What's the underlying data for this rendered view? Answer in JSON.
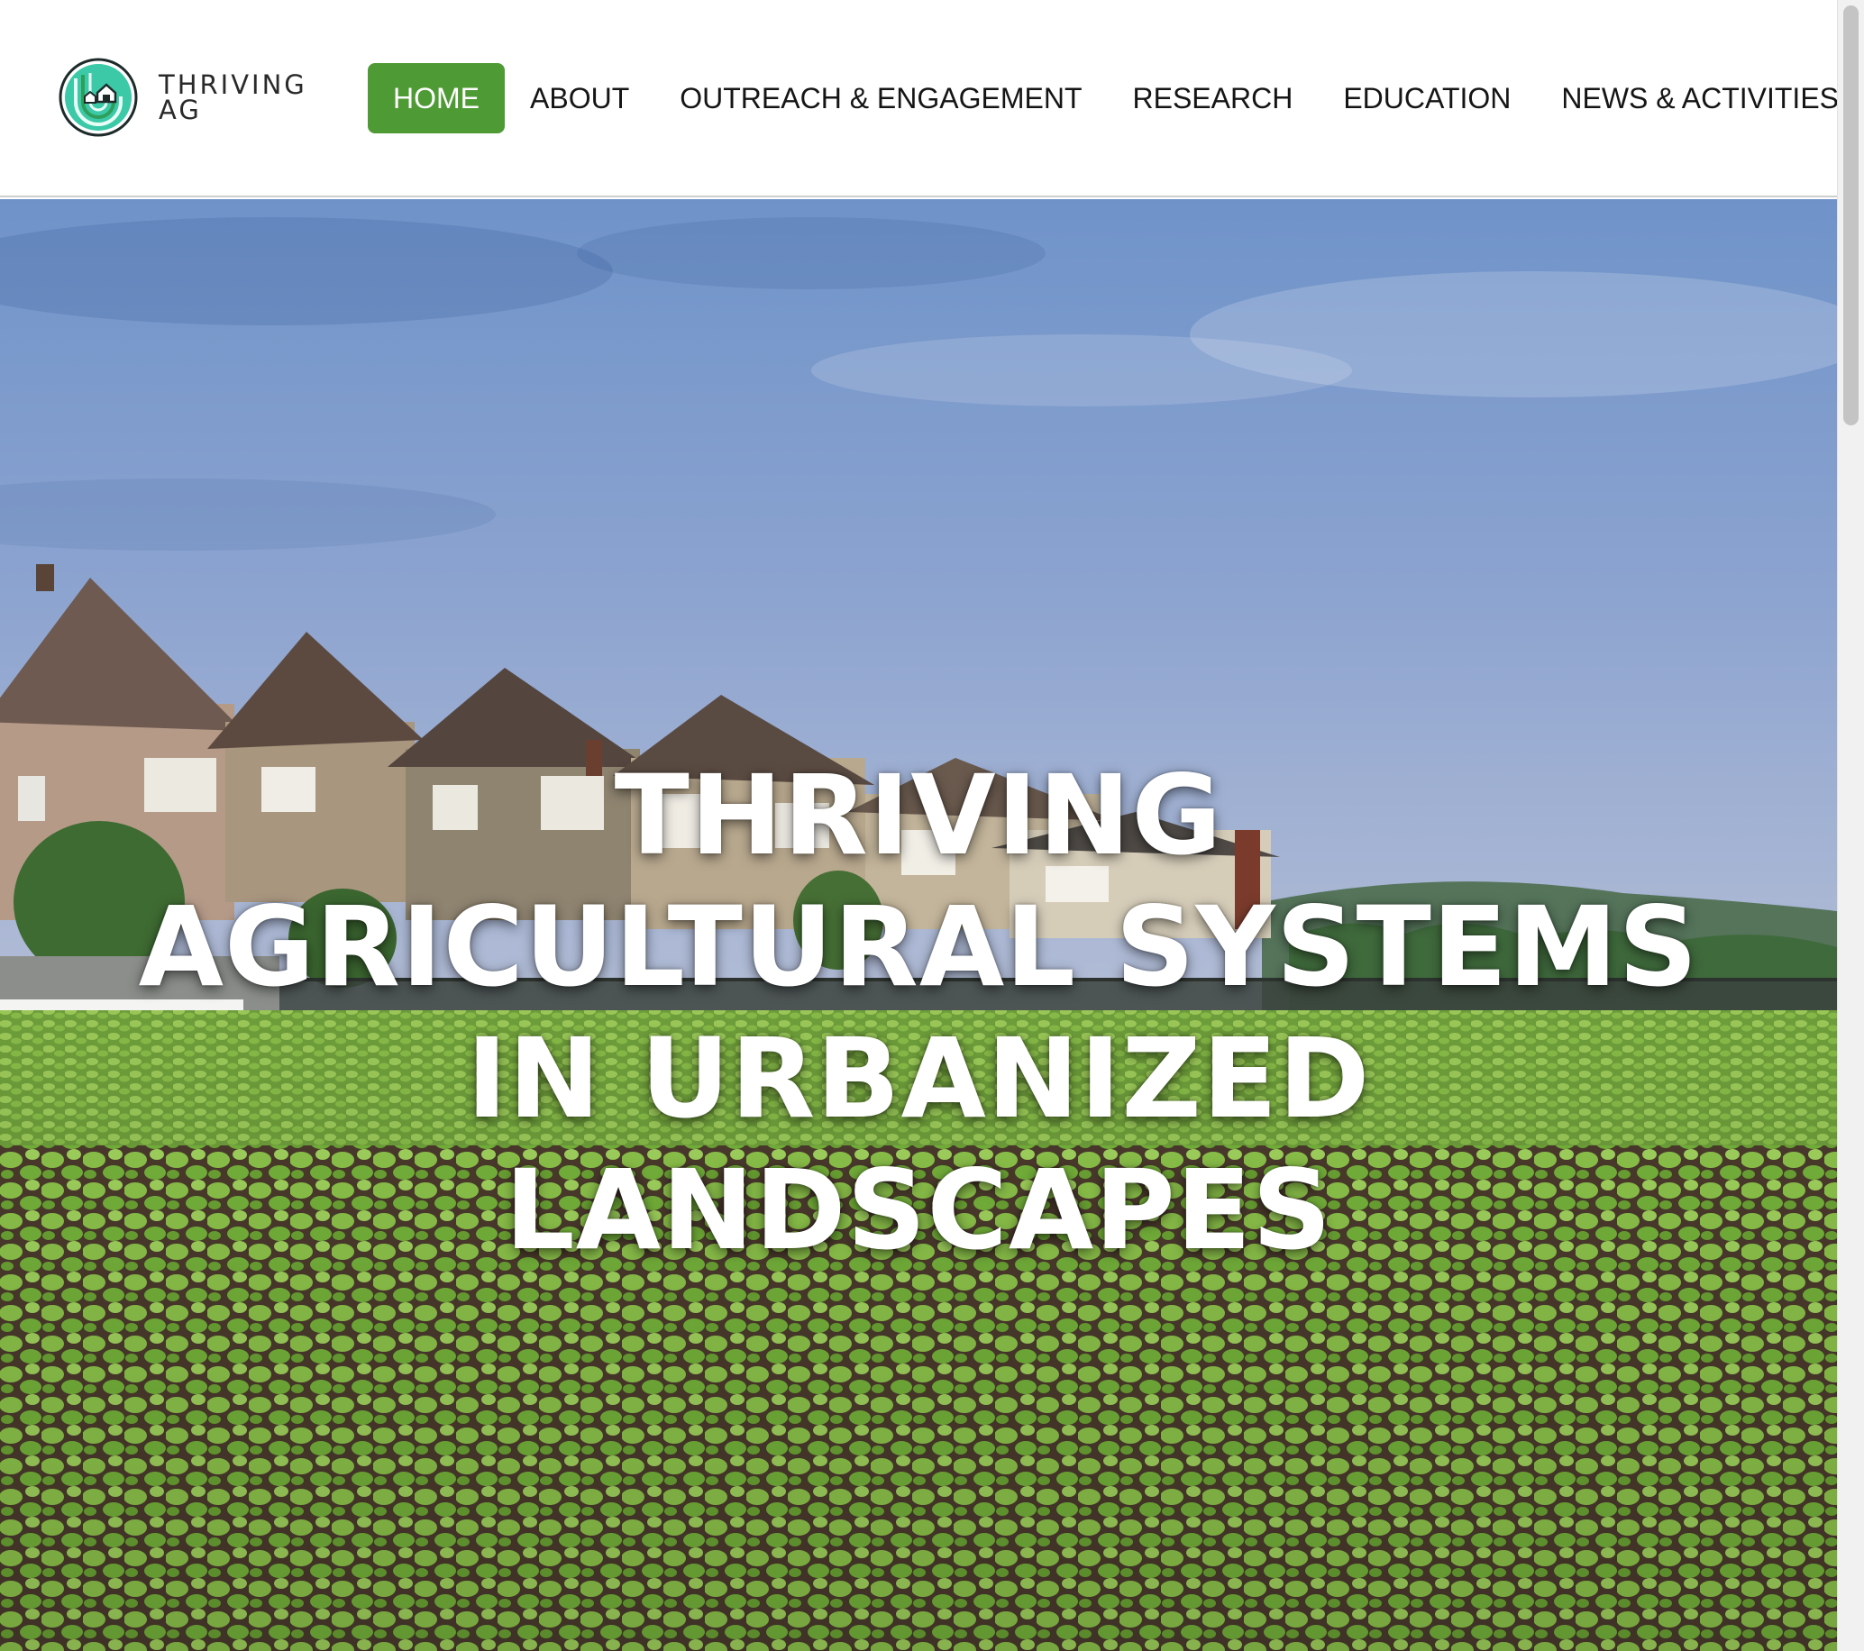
{
  "site": {
    "logo_alt": "THRIVING AG",
    "logo_line1": "THRIVING",
    "logo_line2": "AG"
  },
  "nav": {
    "items": [
      {
        "label": "HOME",
        "active": true
      },
      {
        "label": "ABOUT",
        "active": false
      },
      {
        "label": "OUTREACH & ENGAGEMENT",
        "active": false
      },
      {
        "label": "RESEARCH",
        "active": false
      },
      {
        "label": "EDUCATION",
        "active": false
      },
      {
        "label": "NEWS & ACTIVITIES",
        "active": false
      }
    ]
  },
  "hero": {
    "title": "THRIVING AGRICULTURAL SYSTEMS IN URBANIZED LANDSCAPES"
  },
  "colors": {
    "accent": "#4e9a34",
    "logo_teal": "#3cc9a8",
    "logo_green": "#2f9e5a",
    "nav_text": "#151515"
  },
  "icons": {
    "logo": "thriving-ag-logo-icon"
  }
}
